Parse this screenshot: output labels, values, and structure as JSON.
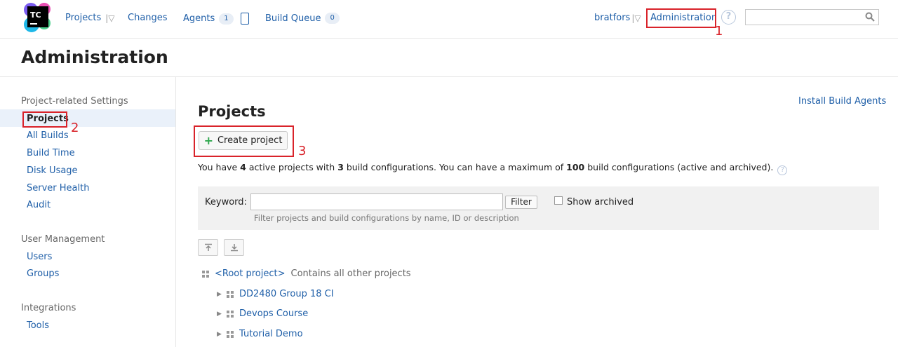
{
  "header": {
    "logo_text": "TC",
    "nav": {
      "projects": "Projects",
      "changes": "Changes",
      "agents": "Agents",
      "agents_count": "1",
      "build_queue": "Build Queue",
      "build_queue_count": "0"
    },
    "user": "bratfors",
    "administration": "Administration",
    "help": "?",
    "search": {
      "value": "",
      "placeholder": ""
    }
  },
  "annotations": {
    "one": "1",
    "two": "2",
    "three": "3"
  },
  "page_title": "Administration",
  "sidebar": {
    "sections": [
      {
        "title": "Project-related Settings",
        "items": [
          "Projects",
          "All Builds",
          "Build Time",
          "Disk Usage",
          "Server Health",
          "Audit"
        ]
      },
      {
        "title": "User Management",
        "items": [
          "Users",
          "Groups"
        ]
      },
      {
        "title": "Integrations",
        "items": [
          "Tools"
        ]
      }
    ],
    "active_item": "Projects"
  },
  "main": {
    "title": "Projects",
    "install_link": "Install Build Agents",
    "create_button": "Create project",
    "summary": {
      "part1": "You have ",
      "active_count": "4",
      "part2": " active projects with ",
      "config_count": "3",
      "part3": " build configurations. You can have a maximum of ",
      "max_count": "100",
      "part4": " build configurations (active and archived)."
    },
    "filter": {
      "keyword_label": "Keyword:",
      "keyword_value": "",
      "filter_button": "Filter",
      "show_archived": "Show archived",
      "show_archived_checked": false,
      "hint": "Filter projects and build configurations by name, ID or description"
    },
    "tree": {
      "root": {
        "name": "<Root project>",
        "description": "Contains all other projects"
      },
      "children": [
        "DD2480 Group 18 CI",
        "Devops Course",
        "Tutorial Demo"
      ]
    }
  },
  "colors": {
    "link": "#1f5fa8",
    "annotation_red": "#d9232a",
    "add_green": "#2fa84f"
  }
}
